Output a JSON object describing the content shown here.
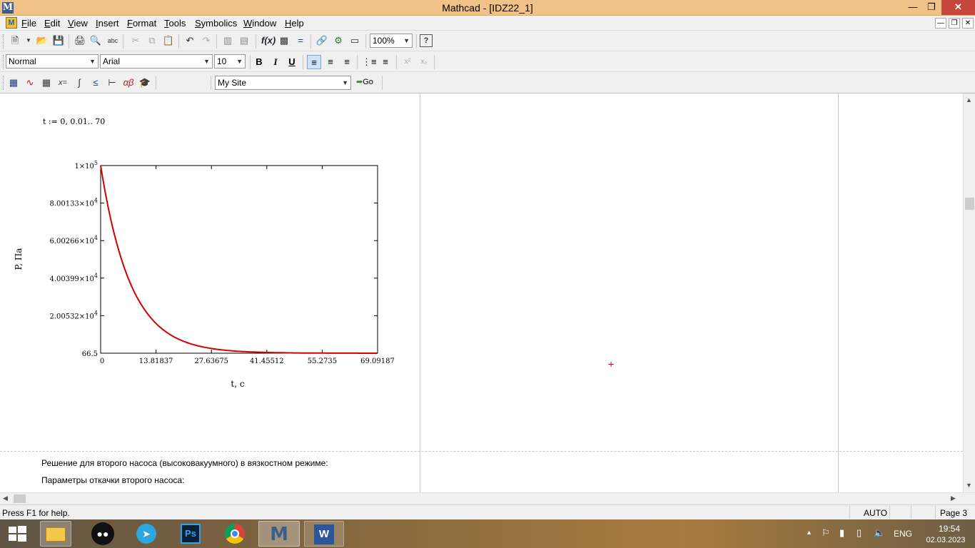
{
  "window": {
    "title": "Mathcad - [IDZ22_1]",
    "app_icon": "M"
  },
  "menu": [
    {
      "label": "File"
    },
    {
      "label": "Edit"
    },
    {
      "label": "View"
    },
    {
      "label": "Insert"
    },
    {
      "label": "Format"
    },
    {
      "label": "Tools"
    },
    {
      "label": "Symbolics"
    },
    {
      "label": "Window"
    },
    {
      "label": "Help"
    }
  ],
  "toolbar": {
    "zoom": "100%"
  },
  "format_bar": {
    "style": "Normal",
    "font": "Arial",
    "size": "10",
    "bold": "B",
    "italic": "I",
    "underline": "U"
  },
  "math_bar": {
    "site": "My Site",
    "go_label": "Go"
  },
  "document": {
    "range_def": "t := 0, 0.01.. 70",
    "text1": "Решение для второго насоса (высоковакуумного) в вязкостном режиме:",
    "text2": "Параметры откачки второго насоса:"
  },
  "chart_data": {
    "type": "line",
    "xlabel": "t, с",
    "ylabel": "P, Па",
    "xlim": [
      0,
      69.09187
    ],
    "ylim": [
      66.5,
      100000
    ],
    "x_ticks": [
      "0",
      "13.81837",
      "27.63675",
      "41.45512",
      "55.2735",
      "69.09187"
    ],
    "y_ticks": [
      {
        "mantissa": "66.5",
        "exp": ""
      },
      {
        "mantissa": "2.00532×10",
        "exp": "4"
      },
      {
        "mantissa": "4.00399×10",
        "exp": "4"
      },
      {
        "mantissa": "6.00266×10",
        "exp": "4"
      },
      {
        "mantissa": "8.00133×10",
        "exp": "4"
      },
      {
        "mantissa": "1×10",
        "exp": "5"
      }
    ],
    "series": [
      {
        "color": "#d40000",
        "function": "P(t) decays exponentially from 1×10^5 to 66.5",
        "tau": 7.5,
        "x_step": 0.5
      }
    ]
  },
  "status": {
    "help": "Press F1 for help.",
    "mode": "AUTO",
    "page": "Page 3"
  },
  "taskbar": {
    "lang": "ENG",
    "time": "19:54",
    "date": "02.03.2023"
  }
}
